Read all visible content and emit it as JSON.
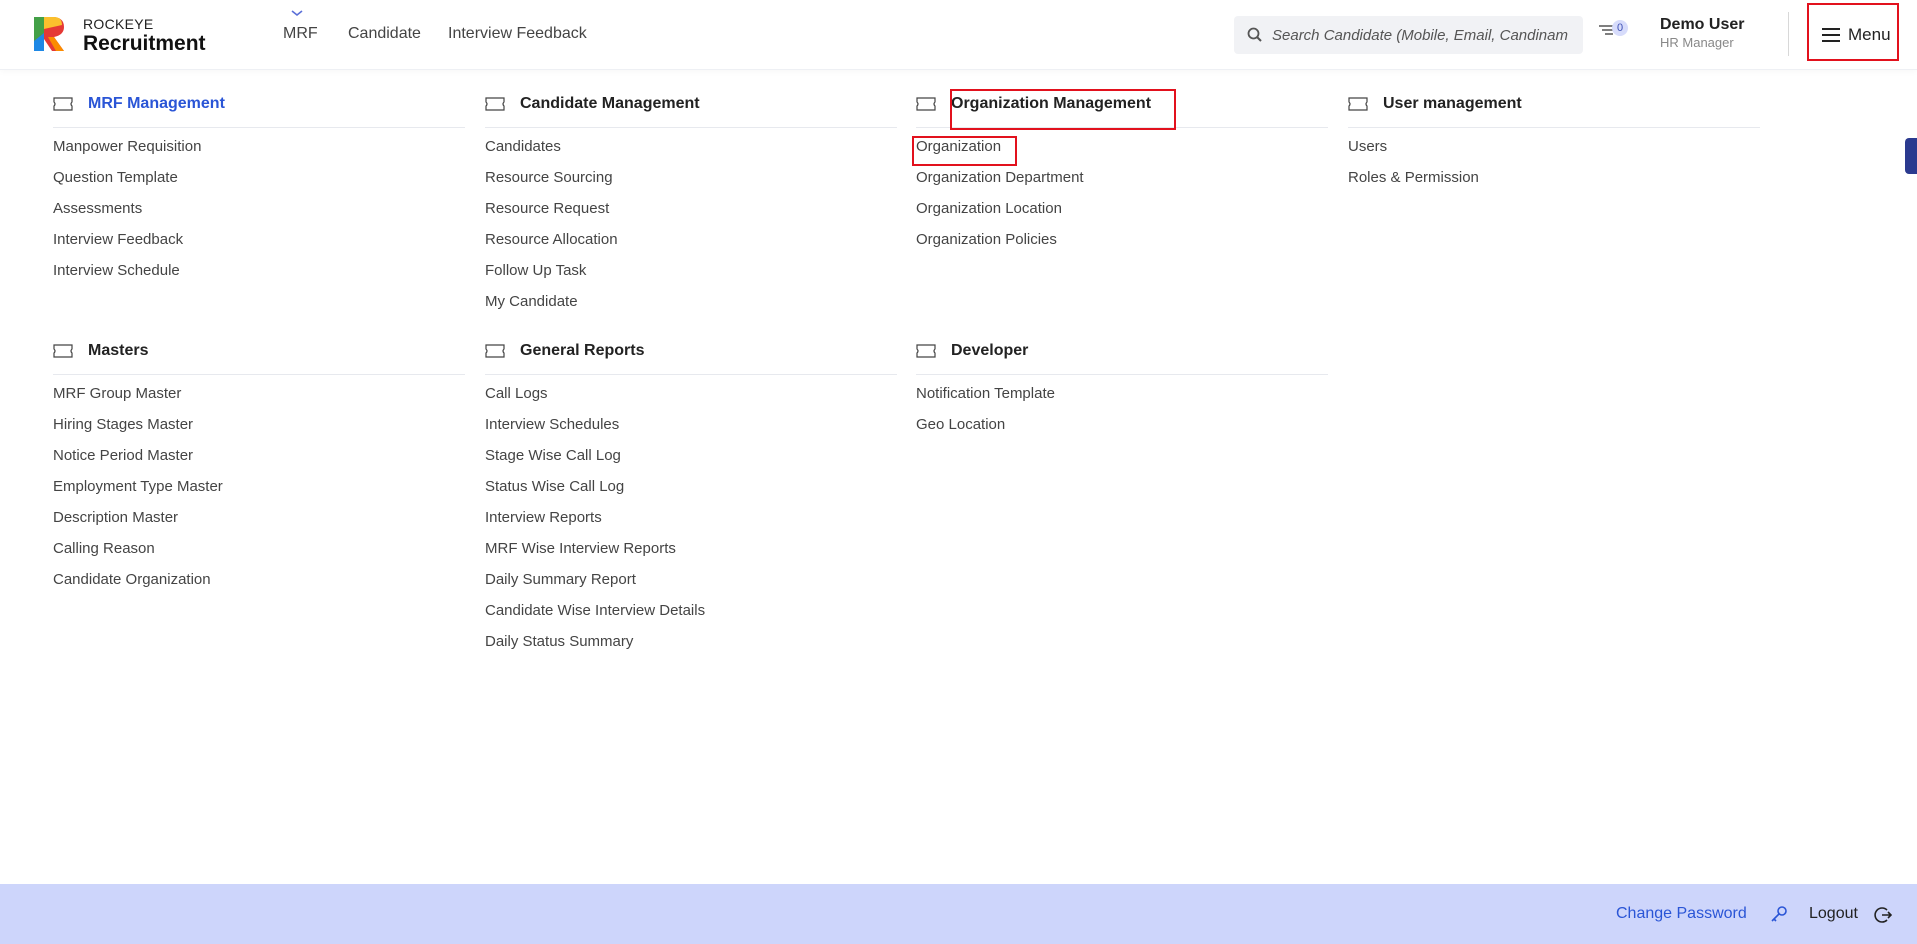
{
  "header": {
    "brand_top": "ROCKEYE",
    "brand_main": "Recruitment",
    "nav": [
      "MRF",
      "Candidate",
      "Interview Feedback"
    ],
    "search_placeholder": "Search Candidate (Mobile, Email, Candinam",
    "notification_count": "0",
    "user_name": "Demo User",
    "user_role": "HR Manager",
    "menu_label": "Menu"
  },
  "sections": [
    {
      "title": "MRF Management",
      "active": true,
      "items": [
        "Manpower Requisition",
        "Question Template",
        "Assessments",
        "Interview Feedback",
        "Interview Schedule"
      ]
    },
    {
      "title": "Candidate Management",
      "items": [
        "Candidates",
        "Resource Sourcing",
        "Resource Request",
        "Resource Allocation",
        "Follow Up Task",
        "My Candidate"
      ]
    },
    {
      "title": "Organization Management",
      "items": [
        "Organization",
        "Organization Department",
        "Organization Location",
        "Organization Policies"
      ]
    },
    {
      "title": "User management",
      "items": [
        "Users",
        "Roles & Permission"
      ]
    },
    {
      "title": "Masters",
      "items": [
        "MRF Group Master",
        "Hiring Stages Master",
        "Notice Period Master",
        "Employment Type Master",
        "Description Master",
        "Calling Reason",
        "Candidate Organization"
      ]
    },
    {
      "title": "General Reports",
      "items": [
        "Call Logs",
        "Interview Schedules",
        "Stage Wise Call Log",
        "Status Wise Call Log",
        "Interview Reports",
        "MRF Wise Interview Reports",
        "Daily Summary Report",
        "Candidate Wise Interview Details",
        "Daily Status Summary"
      ]
    },
    {
      "title": "Developer",
      "items": [
        "Notification Template",
        "Geo Location"
      ]
    }
  ],
  "footer": {
    "change_password": "Change Password",
    "logout": "Logout"
  },
  "colors": {
    "accent": "#2a55d6",
    "highlight": "#e2111d",
    "footer_bg": "#cdd5fb"
  }
}
